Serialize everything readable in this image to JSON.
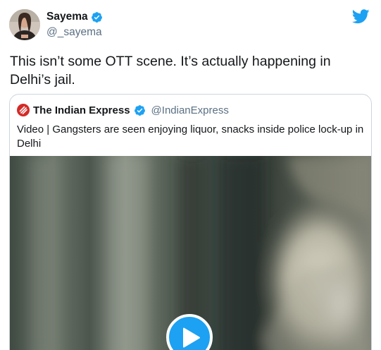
{
  "tweet": {
    "author": {
      "display_name": "Sayema",
      "handle": "@_sayema"
    },
    "text": "This isn’t some OTT scene. It’s actually happening in Delhi’s jail.",
    "quoted": {
      "display_name": "The Indian Express",
      "handle": "@IndianExpress",
      "text": "Video | Gangsters are seen enjoying liquor, snacks inside police lock-up in Delhi"
    }
  },
  "icons": {
    "verified": "verified-badge-icon",
    "brand": "twitter-bird-icon",
    "quoted_avatar": "indian-express-logo",
    "play": "play-icon"
  },
  "colors": {
    "accent": "#1da1f2",
    "text": "#14171a",
    "secondary_text": "#5b7083",
    "border": "#ccd6dd",
    "indian_express_red": "#d42a27"
  }
}
